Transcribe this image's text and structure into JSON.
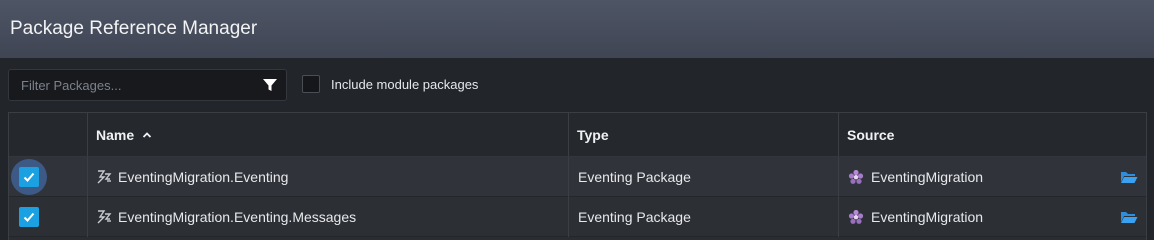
{
  "window": {
    "title": "Package Reference Manager"
  },
  "toolbar": {
    "filter_placeholder": "Filter Packages...",
    "filter_value": "",
    "include_module_label": "Include module packages",
    "include_module_checked": false
  },
  "table": {
    "columns": {
      "name": "Name",
      "type": "Type",
      "source": "Source"
    },
    "sort": {
      "column": "Name",
      "direction": "ascending"
    },
    "rows": [
      {
        "checked": true,
        "name": "EventingMigration.Eventing",
        "type": "Eventing Package",
        "source": "EventingMigration"
      },
      {
        "checked": true,
        "name": "EventingMigration.Eventing.Messages",
        "type": "Eventing Package",
        "source": "EventingMigration"
      }
    ]
  },
  "colors": {
    "checkbox_checked": "#1ba1e2",
    "folder_icon": "#2d8ee0",
    "source_icon": "#b58ad6",
    "title_bar": "#4a5160"
  },
  "icons": {
    "filter": "funnel-icon",
    "sort": "chevron-up-icon",
    "package": "eventing-package-icon",
    "source": "module-icon",
    "open": "open-folder-icon"
  }
}
